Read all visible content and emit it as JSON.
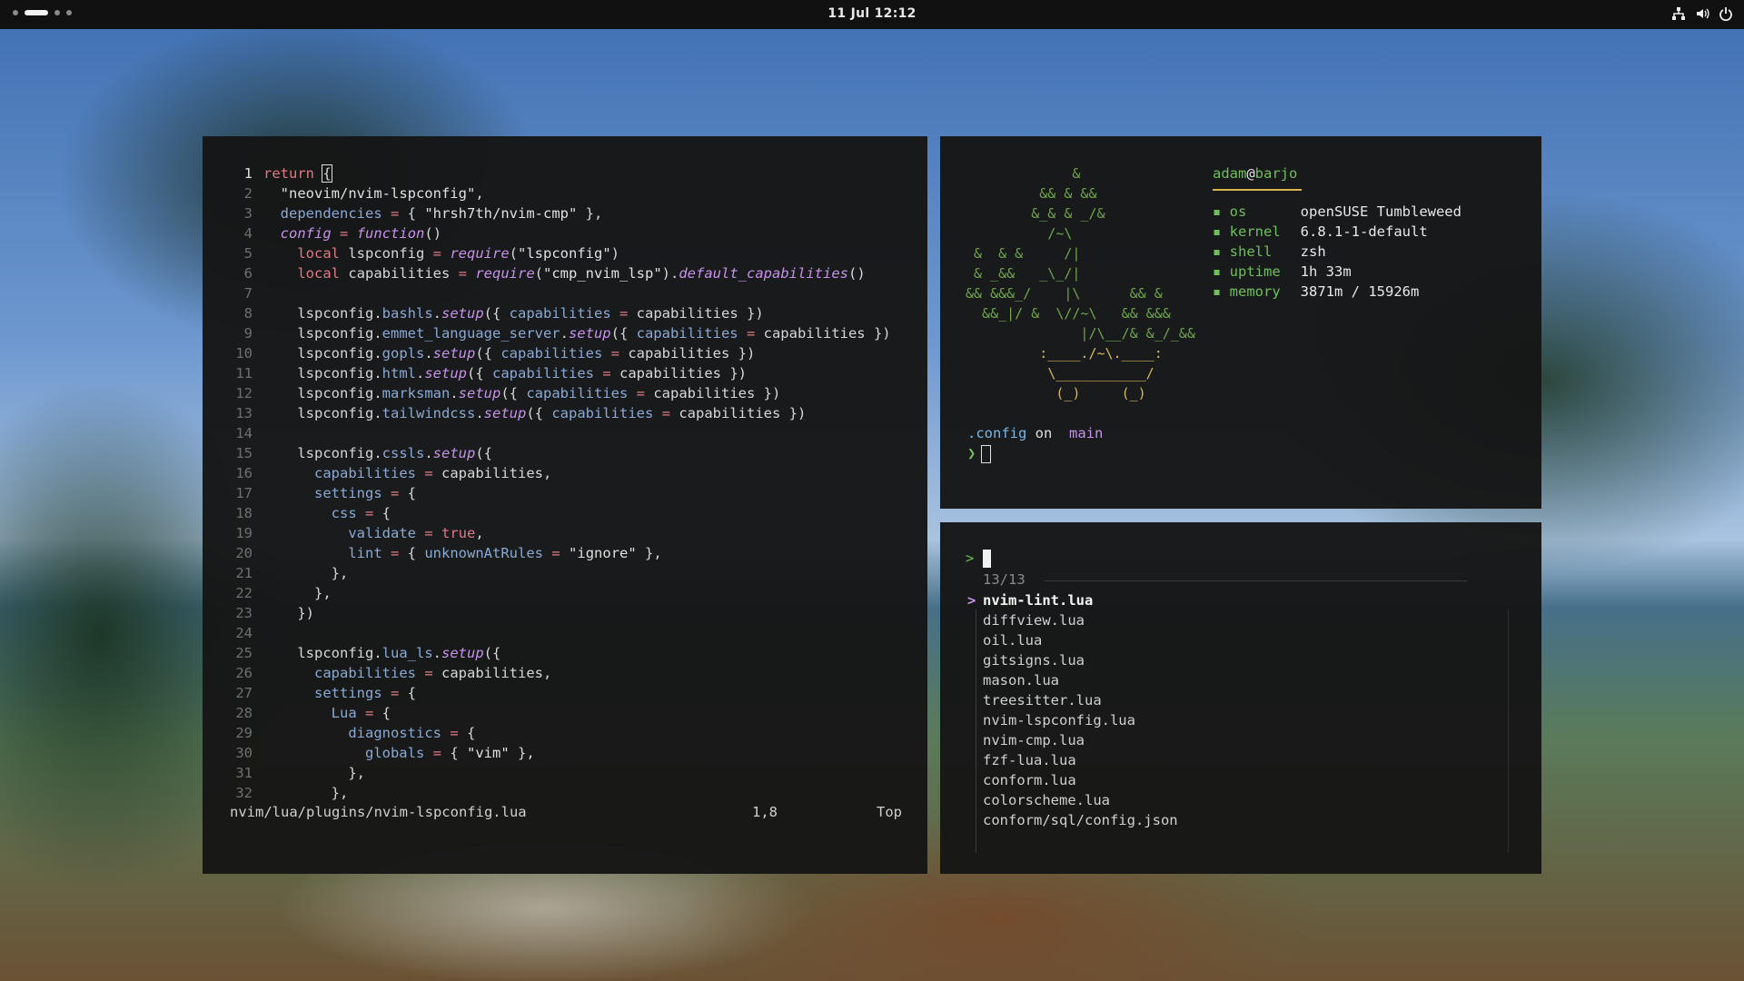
{
  "topbar": {
    "clock": "11 Jul 12:12",
    "tray_icons": [
      "network-icon",
      "volume-icon",
      "power-icon"
    ]
  },
  "editor": {
    "lines": [
      {
        "n": "1",
        "html": "<span class='kw'>return</span> <span class='cursor-box'>{</span>"
      },
      {
        "n": "2",
        "html": "  <span class='str'>\"neovim/nvim-lspconfig\"</span>,"
      },
      {
        "n": "3",
        "html": "  <span class='prop'>dependencies</span> <span class='op'>=</span> { <span class='str'>\"hrsh7th/nvim-cmp\"</span> },"
      },
      {
        "n": "4",
        "html": "  <span class='fn'>config</span> <span class='op'>=</span> <span class='fn'>function</span>()"
      },
      {
        "n": "5",
        "html": "    <span class='kw'>local</span> lspconfig <span class='op'>=</span> <span class='fn'>require</span>(<span class='str'>\"lspconfig\"</span>)"
      },
      {
        "n": "6",
        "html": "    <span class='kw'>local</span> capabilities <span class='op'>=</span> <span class='fn'>require</span>(<span class='str'>\"cmp_nvim_lsp\"</span>).<span class='fn'>default_capabilities</span>()"
      },
      {
        "n": "7",
        "html": ""
      },
      {
        "n": "8",
        "html": "    lspconfig.<span class='prop'>bashls</span>.<span class='fn'>setup</span>({ <span class='prop'>capabilities</span> <span class='op'>=</span> capabilities })"
      },
      {
        "n": "9",
        "html": "    lspconfig.<span class='prop'>emmet_language_server</span>.<span class='fn'>setup</span>({ <span class='prop'>capabilities</span> <span class='op'>=</span> capabilities })"
      },
      {
        "n": "10",
        "html": "    lspconfig.<span class='prop'>gopls</span>.<span class='fn'>setup</span>({ <span class='prop'>capabilities</span> <span class='op'>=</span> capabilities })"
      },
      {
        "n": "11",
        "html": "    lspconfig.<span class='prop'>html</span>.<span class='fn'>setup</span>({ <span class='prop'>capabilities</span> <span class='op'>=</span> capabilities })"
      },
      {
        "n": "12",
        "html": "    lspconfig.<span class='prop'>marksman</span>.<span class='fn'>setup</span>({ <span class='prop'>capabilities</span> <span class='op'>=</span> capabilities })"
      },
      {
        "n": "13",
        "html": "    lspconfig.<span class='prop'>tailwindcss</span>.<span class='fn'>setup</span>({ <span class='prop'>capabilities</span> <span class='op'>=</span> capabilities })"
      },
      {
        "n": "14",
        "html": ""
      },
      {
        "n": "15",
        "html": "    lspconfig.<span class='prop'>cssls</span>.<span class='fn'>setup</span>({"
      },
      {
        "n": "16",
        "html": "      <span class='prop'>capabilities</span> <span class='op'>=</span> capabilities,"
      },
      {
        "n": "17",
        "html": "      <span class='prop'>settings</span> <span class='op'>=</span> {"
      },
      {
        "n": "18",
        "html": "        <span class='prop'>css</span> <span class='op'>=</span> {"
      },
      {
        "n": "19",
        "html": "          <span class='prop'>validate</span> <span class='op'>=</span> <span class='tf'>true</span>,"
      },
      {
        "n": "20",
        "html": "          <span class='prop'>lint</span> <span class='op'>=</span> { <span class='prop'>unknownAtRules</span> <span class='op'>=</span> <span class='str'>\"ignore\"</span> },"
      },
      {
        "n": "21",
        "html": "        },"
      },
      {
        "n": "22",
        "html": "      },"
      },
      {
        "n": "23",
        "html": "    })"
      },
      {
        "n": "24",
        "html": ""
      },
      {
        "n": "25",
        "html": "    lspconfig.<span class='prop'>lua_ls</span>.<span class='fn'>setup</span>({"
      },
      {
        "n": "26",
        "html": "      <span class='prop'>capabilities</span> <span class='op'>=</span> capabilities,"
      },
      {
        "n": "27",
        "html": "      <span class='prop'>settings</span> <span class='op'>=</span> {"
      },
      {
        "n": "28",
        "html": "        <span class='prop'>Lua</span> <span class='op'>=</span> {"
      },
      {
        "n": "29",
        "html": "          <span class='prop'>diagnostics</span> <span class='op'>=</span> {"
      },
      {
        "n": "30",
        "html": "            <span class='prop'>globals</span> <span class='op'>=</span> { <span class='str'>\"vim\"</span> },"
      },
      {
        "n": "31",
        "html": "          },"
      },
      {
        "n": "32",
        "html": "        },"
      }
    ],
    "status_file": "nvim/lua/plugins/nvim-lspconfig.lua",
    "status_pos": "1,8",
    "status_scroll": "Top"
  },
  "fetch": {
    "ascii": [
      "             <span>&amp;</span>",
      "         &amp;&amp; &amp; &amp;&amp;",
      "        &amp;_&amp; &amp; _/&amp;",
      "          /~\\",
      " &amp;  &amp; &amp;     /|",
      " &amp; _&amp;&amp;   _\\_/|",
      "&amp;&amp; &amp;&amp;&amp;_/    |\\      &amp;&amp; &amp;",
      "  &amp;&amp;_|/ &amp;  \\//~\\   &amp;&amp; &amp;&amp;&amp;",
      "              |/\\__/&amp; &amp;_/_&amp;&amp;",
      "         <span class='y'>:____./~\\.____:</span>",
      "          <span class='y'>\\___________/</span>",
      "           <span class='y'>(_)     (_)</span>"
    ],
    "user": "adam",
    "at": "@",
    "host": "barjo",
    "info": [
      {
        "bullet": "▪",
        "key": "os",
        "value": "openSUSE Tumbleweed"
      },
      {
        "bullet": "▪",
        "key": "kernel",
        "value": "6.8.1-1-default"
      },
      {
        "bullet": "▪",
        "key": "shell",
        "value": "zsh"
      },
      {
        "bullet": "▪",
        "key": "uptime",
        "value": "1h 33m"
      },
      {
        "bullet": "▪",
        "key": "memory",
        "value": "3871m / 15926m"
      }
    ],
    "prompt_dir": ".config",
    "prompt_on": "on",
    "prompt_branch_icon": "",
    "prompt_branch": "main",
    "prompt_char": "❯"
  },
  "fzf": {
    "prompt": ">",
    "count": "13/13",
    "items": [
      "nvim-lint.lua",
      "diffview.lua",
      "oil.lua",
      "gitsigns.lua",
      "mason.lua",
      "treesitter.lua",
      "nvim-lspconfig.lua",
      "nvim-cmp.lua",
      "fzf-lua.lua",
      "conform.lua",
      "colorscheme.lua",
      "conform/sql/config.json"
    ],
    "selected_marker": ">"
  }
}
